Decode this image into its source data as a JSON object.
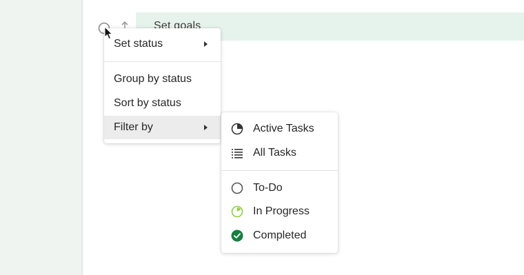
{
  "task": {
    "title": "Set goals"
  },
  "menu": {
    "items": [
      {
        "label": "Set status"
      },
      {
        "label": "Group by status"
      },
      {
        "label": "Sort by status"
      },
      {
        "label": "Filter by"
      }
    ]
  },
  "submenu": {
    "items": [
      {
        "label": "Active Tasks",
        "icon": "pie-icon"
      },
      {
        "label": "All Tasks",
        "icon": "list-icon"
      },
      {
        "label": "To-Do",
        "icon": "empty-circle-icon"
      },
      {
        "label": "In Progress",
        "icon": "progress-circle-icon"
      },
      {
        "label": "Completed",
        "icon": "check-circle-icon"
      }
    ]
  },
  "colors": {
    "accent_green": "#13803f",
    "progress_green": "#8ccf3a",
    "row_highlight": "#e6f3ec",
    "sidebar_bg": "#eff4f1"
  }
}
